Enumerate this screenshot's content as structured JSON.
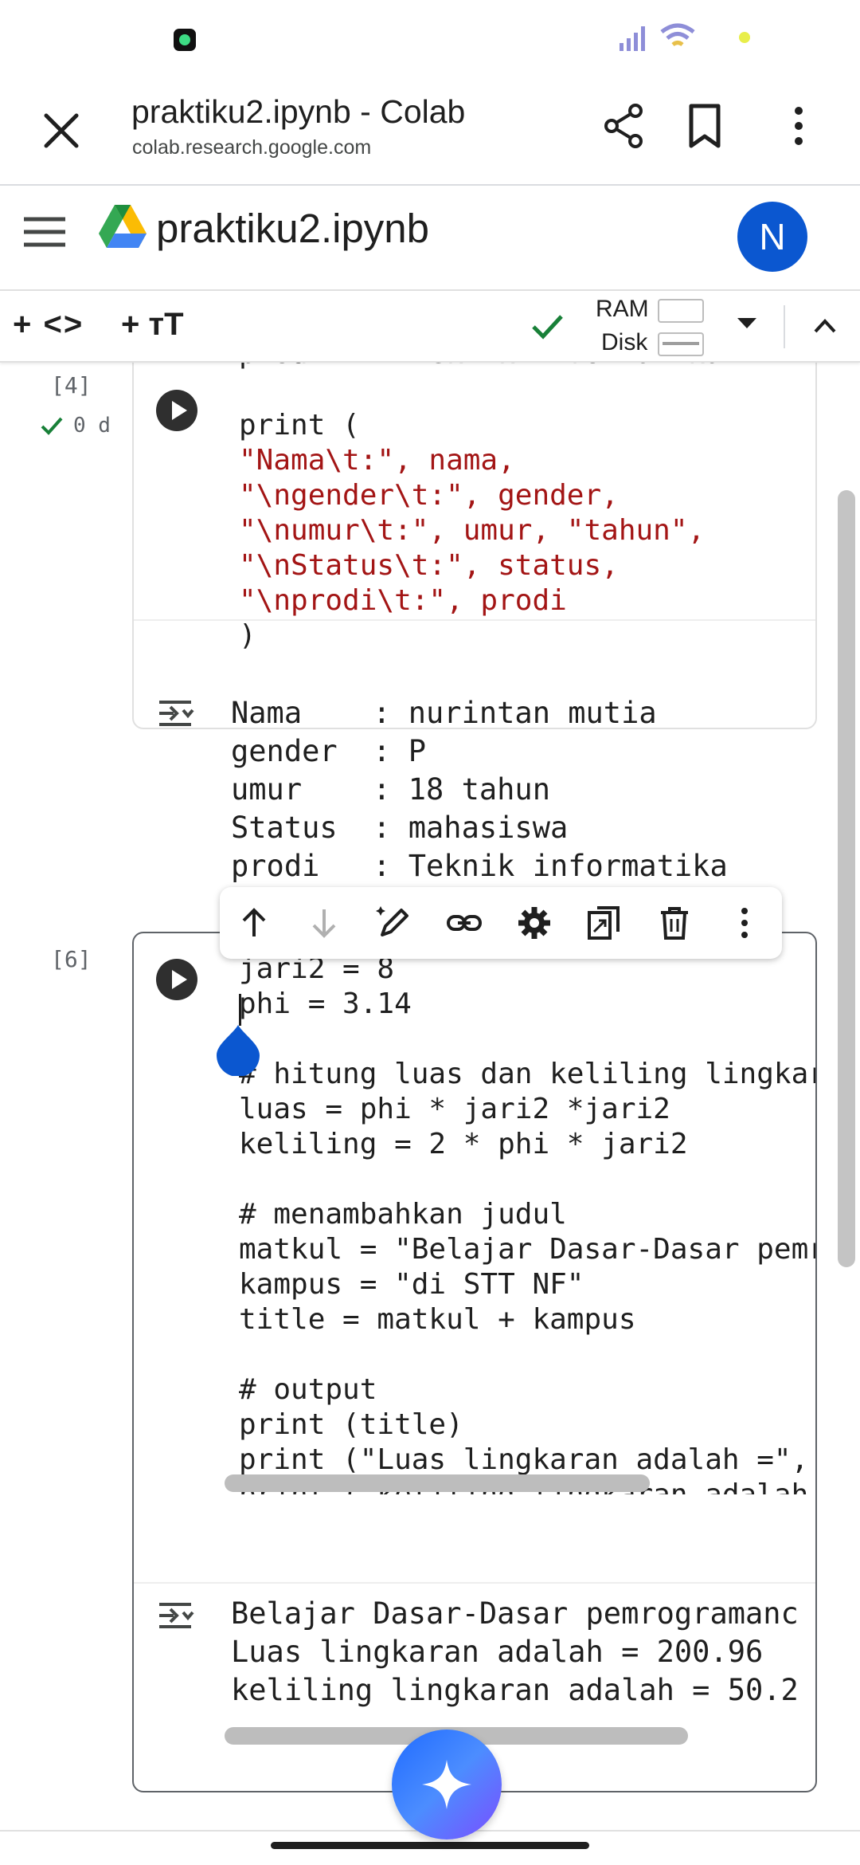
{
  "tab_header": {
    "title": "praktiku2.ipynb - Colab",
    "url": "colab.research.google.com"
  },
  "colab": {
    "notebook_title": "praktiku2.ipynb",
    "avatar_initial": "N"
  },
  "toolbar": {
    "add_code_label": "+ <>",
    "add_text_label": "+ тT",
    "ram_label": "RAM",
    "disk_label": "Disk"
  },
  "cells": [
    {
      "exec_count": "[4]",
      "status": "0 d",
      "partial_top_line": "prodi    \"Teknik informatika\"",
      "code_lines": [
        "print (",
        "\"Nama\\t:\", nama,",
        "\"\\ngender\\t:\", gender,",
        "\"\\numur\\t:\", umur, \"tahun\",",
        "\"\\nStatus\\t:\", status,",
        "\"\\nprodi\\t:\", prodi",
        ")"
      ],
      "output_lines": [
        "Nama    : nurintan mutia",
        "gender  : P",
        "umur    : 18 tahun",
        "Status  : mahasiswa",
        "prodi   : Teknik informatika"
      ]
    },
    {
      "exec_count": "[6]",
      "code_lines": [
        "jari2 = 8",
        "phi = 3.14",
        "",
        "# hitung luas dan keliling lingkar",
        "luas = phi * jari2 *jari2",
        "keliling = 2 * phi * jari2",
        "",
        "# menambahkan judul",
        "matkul = \"Belajar Dasar-Dasar pemr",
        "kampus = \"di STT NF\"",
        "title = matkul + kampus",
        "",
        "# output",
        "print (title)",
        "print (\"Luas lingkaran adalah =\",",
        "print (\"keliling lingkaran adalah"
      ],
      "output_lines": [
        "Belajar Dasar-Dasar pemrogramanc",
        "Luas lingkaran adalah = 200.96",
        "keliling lingkaran adalah = 50.2"
      ]
    }
  ],
  "icons": {
    "status_bar": [
      "whatsapp-icon",
      "signal-icon",
      "wifi-icon",
      "battery-icon"
    ],
    "cell_toolbar": [
      "arrow-up-icon",
      "arrow-down-icon",
      "edit-icon",
      "link-icon",
      "gear-icon",
      "mirror-cell-icon",
      "trash-icon",
      "more-vert-icon"
    ]
  },
  "colors": {
    "string": "#a31515",
    "avatar": "#0b57d0",
    "check": "#188038"
  }
}
